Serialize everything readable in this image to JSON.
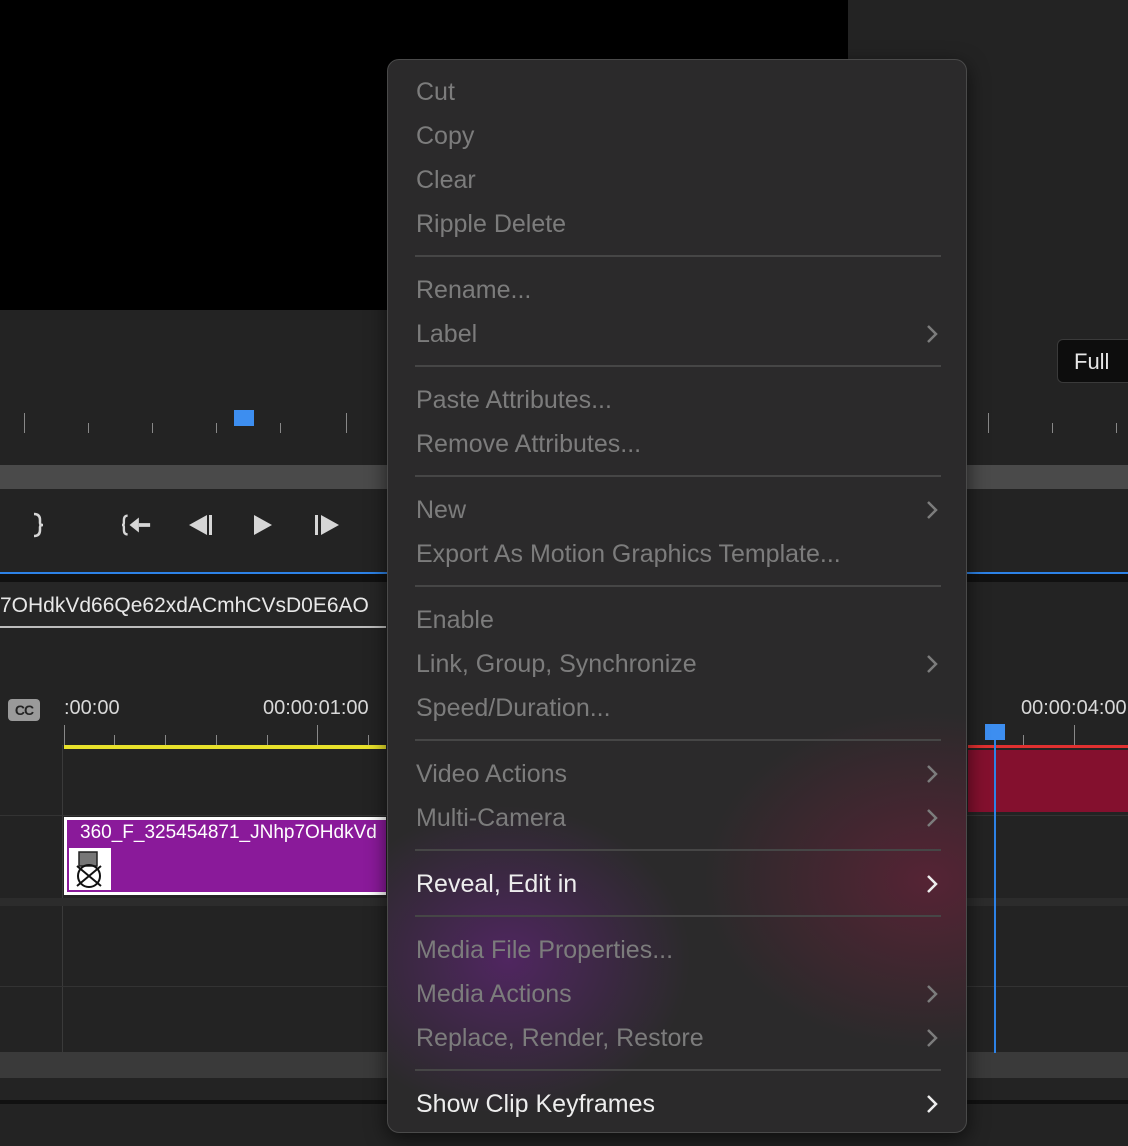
{
  "monitor": {
    "zoom_badge": "Full"
  },
  "transport": {
    "mark_out_icon": "mark-out-icon",
    "go_to_in_icon": "go-to-in-icon",
    "step_back_icon": "step-back-icon",
    "play_icon": "play-icon",
    "step_forward_icon": "step-forward-icon"
  },
  "timeline": {
    "sequence_tab": "7OHdkVd66Qe62xdACmhCVsD0E6AO",
    "cc_label": "CC",
    "timecodes": [
      ":00:00",
      "00:00:01:00",
      "00:00:04:00"
    ],
    "clip_name": "360_F_325454871_JNhp7OHdkVd"
  },
  "context_menu": {
    "items": [
      {
        "label": "Cut",
        "enabled": false,
        "submenu": false
      },
      {
        "label": "Copy",
        "enabled": false,
        "submenu": false
      },
      {
        "label": "Clear",
        "enabled": false,
        "submenu": false
      },
      {
        "label": "Ripple Delete",
        "enabled": false,
        "submenu": false
      },
      {
        "label": "Rename...",
        "enabled": false,
        "submenu": false
      },
      {
        "label": "Label",
        "enabled": false,
        "submenu": true
      },
      {
        "label": "Paste Attributes...",
        "enabled": false,
        "submenu": false
      },
      {
        "label": "Remove Attributes...",
        "enabled": false,
        "submenu": false
      },
      {
        "label": "New",
        "enabled": false,
        "submenu": true
      },
      {
        "label": "Export As Motion Graphics Template...",
        "enabled": false,
        "submenu": false
      },
      {
        "label": "Enable",
        "enabled": false,
        "submenu": false
      },
      {
        "label": "Link, Group, Synchronize",
        "enabled": false,
        "submenu": true
      },
      {
        "label": "Speed/Duration...",
        "enabled": false,
        "submenu": false
      },
      {
        "label": "Video Actions",
        "enabled": false,
        "submenu": true
      },
      {
        "label": "Multi-Camera",
        "enabled": false,
        "submenu": true
      },
      {
        "label": "Reveal, Edit in",
        "enabled": true,
        "submenu": true
      },
      {
        "label": "Media File Properties...",
        "enabled": false,
        "submenu": false
      },
      {
        "label": "Media Actions",
        "enabled": false,
        "submenu": true
      },
      {
        "label": "Replace, Render, Restore",
        "enabled": false,
        "submenu": true
      },
      {
        "label": "Show Clip Keyframes",
        "enabled": true,
        "submenu": true
      }
    ]
  },
  "colors": {
    "accent_blue": "#2d82e6",
    "clip_purple": "#8a1a9a",
    "clip_red": "#84102e",
    "work_area_yellow": "#e8e12b"
  }
}
